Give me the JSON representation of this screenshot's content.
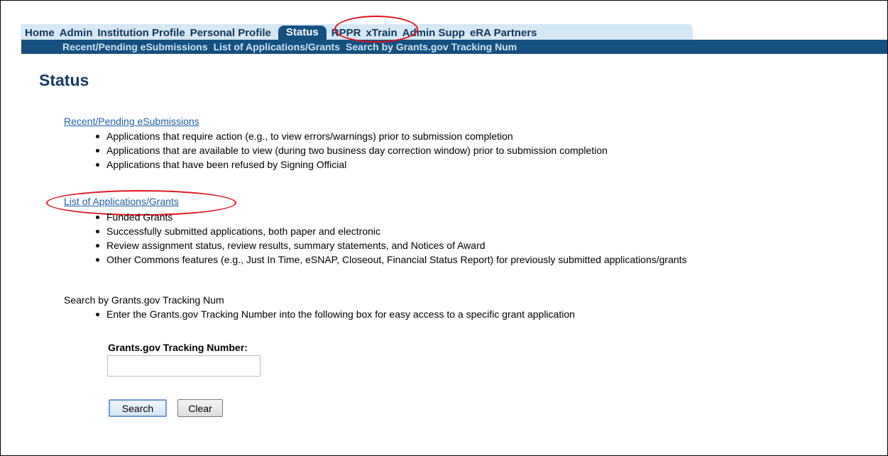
{
  "nav": {
    "items": [
      "Home",
      "Admin",
      "Institution Profile",
      "Personal Profile",
      "Status",
      "RPPR",
      "xTrain",
      "Admin Supp",
      "eRA Partners"
    ],
    "active": "Status"
  },
  "subnav": {
    "items": [
      "Recent/Pending eSubmissions",
      "List of Applications/Grants",
      "Search by Grants.gov Tracking Num"
    ]
  },
  "page": {
    "title": "Status"
  },
  "sections": {
    "recent": {
      "title": "Recent/Pending eSubmissions",
      "bullets": [
        "Applications that require action (e.g., to view errors/warnings) prior to submission completion",
        "Applications that are available to view (during two business day correction window) prior to submission completion",
        "Applications that have been refused by Signing Official"
      ]
    },
    "list": {
      "title": "List of Applications/Grants",
      "bullets": [
        "Funded Grants",
        "Successfully submitted applications, both paper and electronic",
        "Review assignment status, review results, summary statements, and Notices of Award",
        "Other Commons features (e.g., Just In Time, eSNAP, Closeout, Financial Status Report) for previously submitted applications/grants"
      ]
    },
    "search": {
      "title": "Search by Grants.gov Tracking Num",
      "bullets": [
        "Enter the Grants.gov Tracking Number into the following box for easy access to a specific grant application"
      ]
    }
  },
  "form": {
    "label": "Grants.gov Tracking Number:",
    "value": "",
    "search_label": "Search",
    "clear_label": "Clear"
  },
  "colors": {
    "nav_bg": "#d7e8f5",
    "subnav_bg": "#16507f",
    "highlight_ring": "#e0101a"
  }
}
